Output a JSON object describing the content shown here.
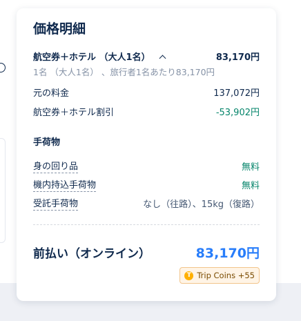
{
  "card": {
    "title": "価格明細",
    "package": {
      "label": "航空券＋ホテル （大人1名）",
      "price": "83,170円",
      "sub": "1名 （大人1名） 、旅行者1名あたり83,170円"
    },
    "original_price": {
      "label": "元の料金",
      "value": "137,072円"
    },
    "discount": {
      "label": "航空券＋ホテル割引",
      "value": "-53,902円"
    },
    "baggage": {
      "title": "手荷物",
      "items": [
        {
          "label": "身の回り品",
          "value": "無料"
        },
        {
          "label": "機内持込手荷物",
          "value": "無料"
        },
        {
          "label": "受託手荷物",
          "value": "なし（往路）、15kg（復路）"
        }
      ]
    },
    "total": {
      "label": "前払い（オンライン）",
      "value": "83,170円"
    },
    "trip_coins": {
      "label": "Trip Coins +55",
      "icon": "coin-icon"
    }
  }
}
